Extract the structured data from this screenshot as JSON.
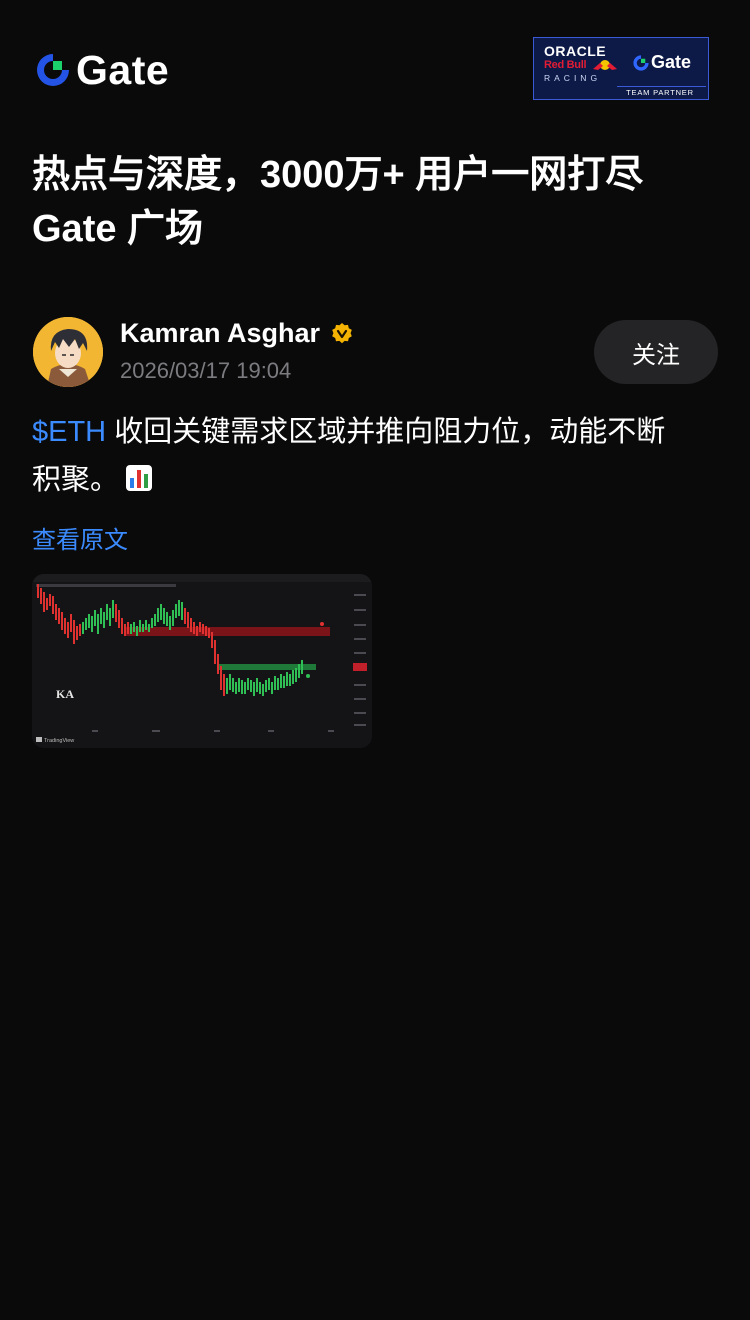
{
  "header": {
    "brand": "Gate",
    "partner": {
      "line1": "ORACLE",
      "line2": "Red Bull",
      "line3": "RACING",
      "brand": "Gate",
      "tag": "TEAM PARTNER"
    }
  },
  "headline": {
    "line1": "热点与深度，3000万+ 用户一网打尽",
    "line2": "Gate 广场"
  },
  "post": {
    "author": "Kamran Asghar",
    "timestamp": "2026/03/17 19:04",
    "follow_label": "关注",
    "ticker": "$ETH",
    "text_line1": " 收回关键需求区域并推向阻力位，动能不断",
    "text_line2": "积聚。",
    "view_original": "查看原文",
    "chart_watermark": "TradingView"
  },
  "colors": {
    "background": "#0a0a0b",
    "accent_blue": "#3b8bff",
    "brand_green": "#1bd16b",
    "verified_gold": "#f5b301"
  }
}
